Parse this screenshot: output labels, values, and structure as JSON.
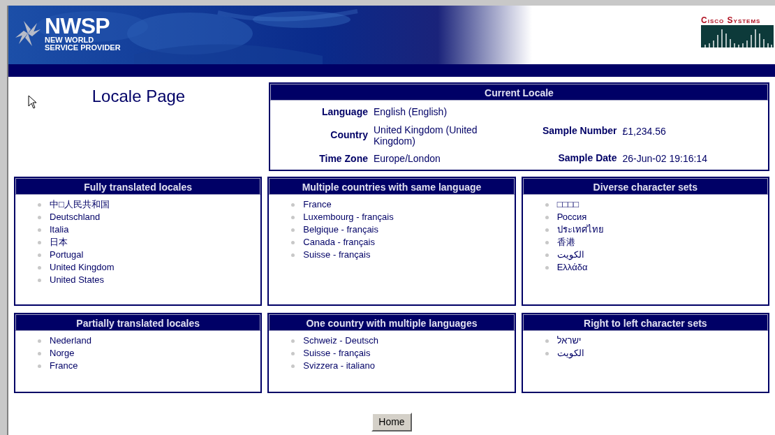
{
  "banner": {
    "title": "NWSP",
    "subtitle_lines": [
      "NEW WORLD",
      "SERVICE PROVIDER"
    ],
    "partner_logo": "Cisco Systems"
  },
  "page_title": "Locale Page",
  "current_locale": {
    "title": "Current Locale",
    "left_fields": [
      {
        "label": "Language",
        "value": "English (English)"
      },
      {
        "label": "Country",
        "value": "United Kingdom (United Kingdom)"
      },
      {
        "label": "Time Zone",
        "value": "Europe/London"
      }
    ],
    "right_fields": [
      {
        "label": "Sample Number",
        "value": "£1,234.56"
      },
      {
        "label": "Sample Date",
        "value": "26-Jun-02 19:16:14"
      }
    ]
  },
  "panels": [
    {
      "title": "Fully translated locales",
      "items": [
        "中□人民共和国",
        "Deutschland",
        "Italia",
        "日本",
        "Portugal",
        "United Kingdom",
        "United States"
      ]
    },
    {
      "title": "Multiple countries with same language",
      "items": [
        "France",
        "Luxembourg - français",
        "Belgique - français",
        "Canada - français",
        "Suisse - français"
      ]
    },
    {
      "title": "Diverse character sets",
      "items": [
        "□□□□",
        "Россия",
        "ประเทศไทย",
        "香港",
        "الكويت",
        "Ελλάδα"
      ]
    },
    {
      "title": "Partially translated locales",
      "items": [
        "Nederland",
        "Norge",
        "France"
      ]
    },
    {
      "title": "One country with multiple languages",
      "items": [
        "Schweiz - Deutsch",
        "Suisse - français",
        "Svizzera - italiano"
      ]
    },
    {
      "title": "Right to left character sets",
      "items": [
        "ישראל",
        "الكويت"
      ]
    }
  ],
  "home_button": "Home"
}
